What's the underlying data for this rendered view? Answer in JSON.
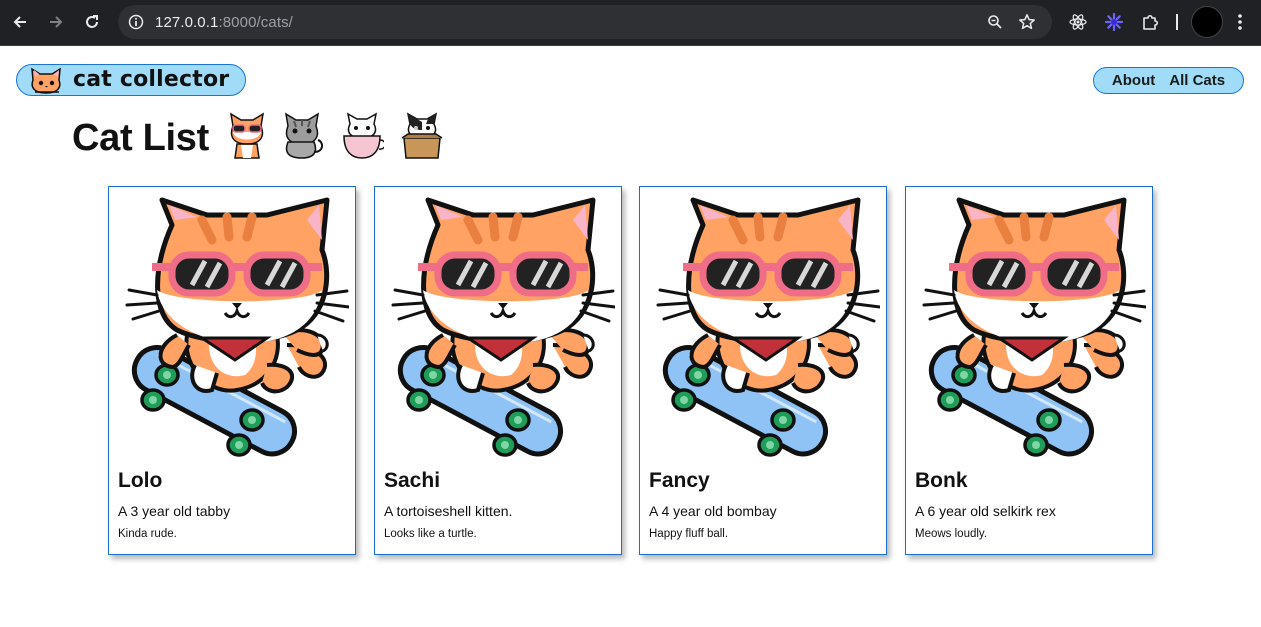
{
  "browser": {
    "url_host": "127.0.0.1",
    "url_rest": ":8000/cats/"
  },
  "app": {
    "logo_text": "cat collector",
    "nav": [
      {
        "label": "About"
      },
      {
        "label": "All Cats"
      }
    ]
  },
  "page": {
    "title": "Cat List"
  },
  "cats": [
    {
      "name": "Lolo",
      "description": "A 3 year old tabby",
      "note": "Kinda rude."
    },
    {
      "name": "Sachi",
      "description": "A tortoiseshell kitten.",
      "note": "Looks like a turtle."
    },
    {
      "name": "Fancy",
      "description": "A 4 year old bombay",
      "note": "Happy fluff ball."
    },
    {
      "name": "Bonk",
      "description": "A 6 year old selkirk rex",
      "note": "Meows loudly."
    }
  ],
  "colors": {
    "accent_border": "#1a73d9",
    "pill_fill": "#a0dcf7",
    "card_border": "#1a6fcf",
    "chrome_bg": "#202124"
  }
}
